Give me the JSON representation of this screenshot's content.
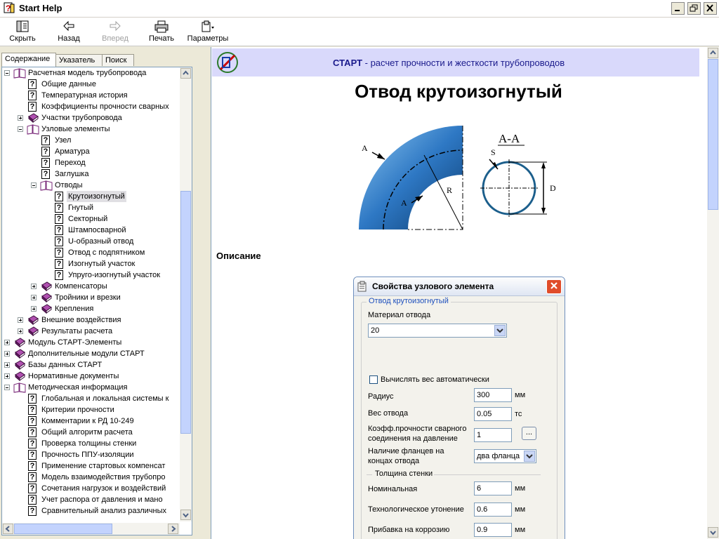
{
  "window": {
    "title": "Start Help"
  },
  "toolbar": {
    "hide": "Скрыть",
    "back": "Назад",
    "forward": "Вперед",
    "print": "Печать",
    "options": "Параметры"
  },
  "tabs": [
    "Содержание",
    "Указатель",
    "Поиск"
  ],
  "tree": [
    {
      "label": "Расчетная модель трубопровода",
      "type": "book-open",
      "level": 0,
      "exp": "minus"
    },
    {
      "label": "Общие данные",
      "type": "page",
      "level": 1
    },
    {
      "label": "Температурная история",
      "type": "page",
      "level": 1
    },
    {
      "label": "Коэффициенты прочности сварных",
      "type": "page",
      "level": 1
    },
    {
      "label": "Участки трубопровода",
      "type": "book",
      "level": 1,
      "exp": "plus"
    },
    {
      "label": "Узловые элементы",
      "type": "book-open",
      "level": 1,
      "exp": "minus"
    },
    {
      "label": "Узел",
      "type": "page",
      "level": 2
    },
    {
      "label": "Арматура",
      "type": "page",
      "level": 2
    },
    {
      "label": "Переход",
      "type": "page",
      "level": 2
    },
    {
      "label": "Заглушка",
      "type": "page",
      "level": 2
    },
    {
      "label": "Отводы",
      "type": "book-open",
      "level": 2,
      "exp": "minus"
    },
    {
      "label": "Крутоизогнутый",
      "type": "page",
      "level": 3,
      "selected": true
    },
    {
      "label": "Гнутый",
      "type": "page",
      "level": 3
    },
    {
      "label": "Секторный",
      "type": "page",
      "level": 3
    },
    {
      "label": "Штампосварной",
      "type": "page",
      "level": 3
    },
    {
      "label": "U-образный отвод",
      "type": "page",
      "level": 3
    },
    {
      "label": "Отвод с подпятником",
      "type": "page",
      "level": 3
    },
    {
      "label": "Изогнутый участок",
      "type": "page",
      "level": 3
    },
    {
      "label": "Упруго-изогнутый участок",
      "type": "page",
      "level": 3
    },
    {
      "label": "Компенсаторы",
      "type": "book",
      "level": 2,
      "exp": "plus"
    },
    {
      "label": "Тройники и врезки",
      "type": "book",
      "level": 2,
      "exp": "plus"
    },
    {
      "label": "Крепления",
      "type": "book",
      "level": 2,
      "exp": "plus"
    },
    {
      "label": "Внешние воздействия",
      "type": "book",
      "level": 1,
      "exp": "plus"
    },
    {
      "label": "Результаты расчета",
      "type": "book",
      "level": 1,
      "exp": "plus"
    },
    {
      "label": "Модуль СТАРТ-Элементы",
      "type": "book",
      "level": 0,
      "exp": "plus"
    },
    {
      "label": "Дополнительные модули СТАРТ",
      "type": "book",
      "level": 0,
      "exp": "plus"
    },
    {
      "label": "Базы данных СТАРТ",
      "type": "book",
      "level": 0,
      "exp": "plus"
    },
    {
      "label": "Нормативные документы",
      "type": "book",
      "level": 0,
      "exp": "plus"
    },
    {
      "label": "Методическая информация",
      "type": "book-open",
      "level": 0,
      "exp": "minus"
    },
    {
      "label": "Глобальная и локальная системы к",
      "type": "page",
      "level": 1
    },
    {
      "label": "Критерии прочности",
      "type": "page",
      "level": 1
    },
    {
      "label": "Комментарии к РД 10-249",
      "type": "page",
      "level": 1
    },
    {
      "label": "Общий алгоритм расчета",
      "type": "page",
      "level": 1
    },
    {
      "label": "Проверка толщины стенки",
      "type": "page",
      "level": 1
    },
    {
      "label": "Прочность ППУ-изоляции",
      "type": "page",
      "level": 1
    },
    {
      "label": "Применение стартовых компенсат",
      "type": "page",
      "level": 1
    },
    {
      "label": "Модель взаимодействия трубопро",
      "type": "page",
      "level": 1
    },
    {
      "label": "Сочетания нагрузок и воздействий",
      "type": "page",
      "level": 1
    },
    {
      "label": "Учет распора от давления и мано",
      "type": "page",
      "level": 1
    },
    {
      "label": "Сравнительный анализ различных",
      "type": "page",
      "level": 1
    }
  ],
  "content": {
    "banner_brand": "СТАРТ",
    "banner_rest": " - расчет прочности и жесткости  трубопроводов",
    "heading": "Отвод крутоизогнутый",
    "description_heading": "Описание",
    "drawing": {
      "section": "А-А",
      "label_a": "A",
      "label_r": "R",
      "label_s": "S",
      "label_d": "D"
    }
  },
  "dialog": {
    "title": "Свойства узлового элемента",
    "group_title": "Отвод крутоизогнутый",
    "material_label": "Материал отвода",
    "material_value": "20",
    "auto_weight_label": "Вычислять вес автоматически",
    "radius_label": "Радиус",
    "radius_value": "300",
    "radius_unit": "мм",
    "weight_label": "Вес отвода",
    "weight_value": "0.05",
    "weight_unit": "тс",
    "weld_label_1": "Коэфф.прочности сварного",
    "weld_label_2": "соединения на давление",
    "weld_value": "1",
    "weld_button": "...",
    "flanges_label_1": "Наличие фланцев на",
    "flanges_label_2": "концах отвода",
    "flanges_value": "два фланца",
    "wall_section": "Толщина стенки",
    "nominal_label": "Номинальная",
    "nominal_value": "6",
    "nominal_unit": "мм",
    "thinning_label": "Технологическое утонение",
    "thinning_value": "0.6",
    "thinning_unit": "мм",
    "corrosion_label": "Прибавка на коррозию",
    "corrosion_value": "0.9",
    "corrosion_unit": "мм"
  },
  "colors": {
    "banner": "#d9d9fb",
    "brand_text": "#1a1a8c",
    "pipe": "#3f8fd0",
    "close": "#e04c2a",
    "book": "#7a2a7a"
  }
}
